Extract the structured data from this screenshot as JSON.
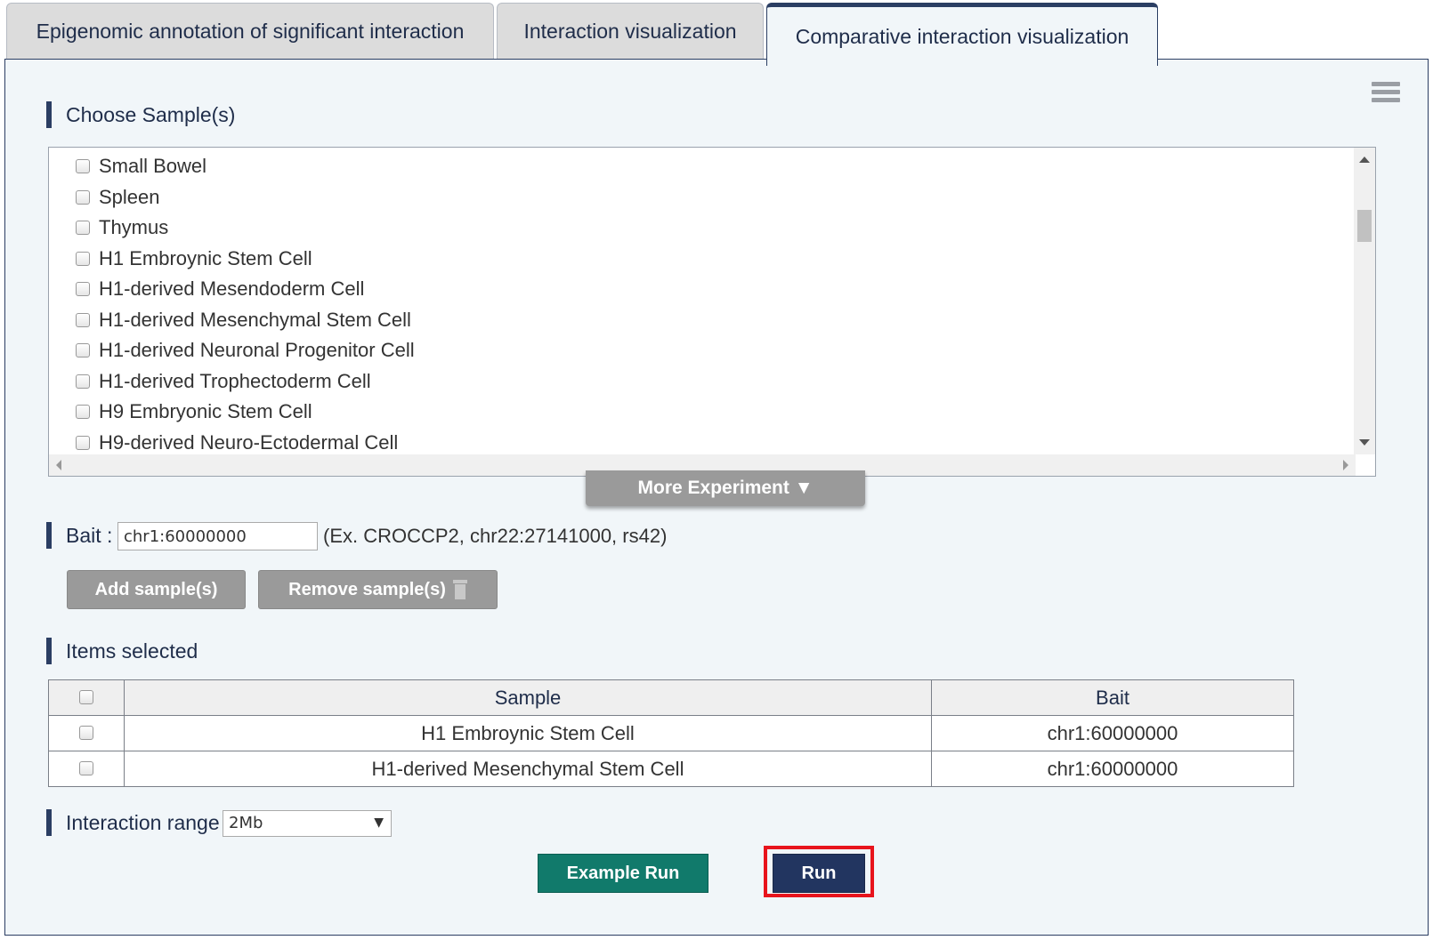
{
  "tabs": [
    {
      "label": "Epigenomic annotation of significant interaction"
    },
    {
      "label": "Interaction visualization"
    },
    {
      "label": "Comparative interaction visualization",
      "active": true
    }
  ],
  "choose_samples": {
    "title": "Choose Sample(s)",
    "items": [
      "Small Bowel",
      "Spleen",
      "Thymus",
      "H1 Embroynic Stem Cell",
      "H1-derived Mesendoderm Cell",
      "H1-derived Mesenchymal Stem Cell",
      "H1-derived Neuronal Progenitor Cell",
      "H1-derived Trophectoderm Cell",
      "H9 Embryonic Stem Cell",
      "H9-derived Neuro-Ectodermal Cell"
    ],
    "more_button": "More Experiment ▼"
  },
  "bait": {
    "label": "Bait :",
    "value": "chr1:60000000",
    "example": "(Ex. CROCCP2, chr22:27141000, rs42)"
  },
  "buttons": {
    "add": "Add sample(s)",
    "remove": "Remove sample(s)",
    "example_run": "Example Run",
    "run": "Run"
  },
  "items_selected": {
    "title": "Items selected",
    "columns": [
      "Sample",
      "Bait"
    ],
    "rows": [
      {
        "sample": "H1 Embroynic Stem Cell",
        "bait": "chr1:60000000"
      },
      {
        "sample": "H1-derived Mesenchymal Stem Cell",
        "bait": "chr1:60000000"
      }
    ]
  },
  "interaction_range": {
    "label": "Interaction range",
    "selected": "2Mb"
  },
  "colors": {
    "navy": "#223560",
    "green": "#117a6b",
    "highlight": "#e8141c",
    "panel_bg": "#f1f6f9"
  }
}
